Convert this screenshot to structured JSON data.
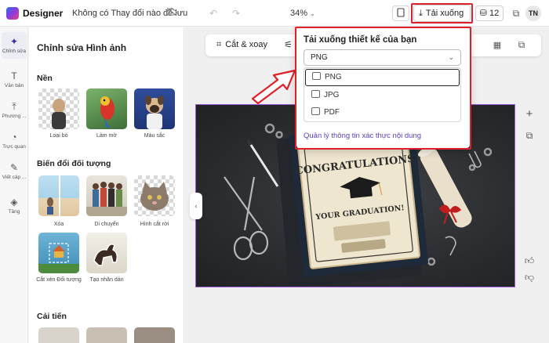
{
  "app": {
    "name": "Designer",
    "doc_title": "Không có Thay đổi nào để lưu"
  },
  "header": {
    "zoom": "34%",
    "download_label": "Tải xuống",
    "count_label": "12",
    "avatar_initials": "TN"
  },
  "rail": {
    "items": [
      {
        "label": "Chỉnh sửa",
        "icon": "sparkle-icon"
      },
      {
        "label": "Văn bản",
        "icon": "text-icon"
      },
      {
        "label": "Phương ...",
        "icon": "media-icon"
      },
      {
        "label": "Trực quan",
        "icon": "visuals-icon"
      },
      {
        "label": "Viết cáp ...",
        "icon": "pen-icon"
      },
      {
        "label": "Tầng",
        "icon": "layers-icon"
      }
    ]
  },
  "panel": {
    "title": "Chỉnh sửa Hình ảnh",
    "sections": {
      "background": "Nền",
      "transform": "Biến đổi đối tượng",
      "improve": "Cải tiến"
    },
    "background_items": [
      {
        "label": "Loại bỏ"
      },
      {
        "label": "Làm mờ"
      },
      {
        "label": "Màu sắc"
      }
    ],
    "transform_items": [
      {
        "label": "Xóa"
      },
      {
        "label": "Di chuyển"
      },
      {
        "label": "Hình cắt rời"
      },
      {
        "label": "Cắt xén Đối tượng"
      },
      {
        "label": "Tạo nhãn dán"
      }
    ]
  },
  "canvas_toolbar": {
    "crop_label": "Cắt & xoay"
  },
  "download_panel": {
    "title": "Tải xuống thiết kế của bạn",
    "selected_format": "PNG",
    "options": [
      {
        "label": "PNG"
      },
      {
        "label": "JPG"
      },
      {
        "label": "PDF"
      }
    ],
    "manage_link": "Quản lý thông tin xác thực nội dung"
  },
  "canvas": {
    "card_text_top": "CONGRATULATIONS",
    "card_text_bottom": "YOUR GRADUATION!"
  },
  "colors": {
    "highlight_red": "#e0202a",
    "accent_purple": "#5b3fc4",
    "selection_border": "#9b59d8"
  }
}
